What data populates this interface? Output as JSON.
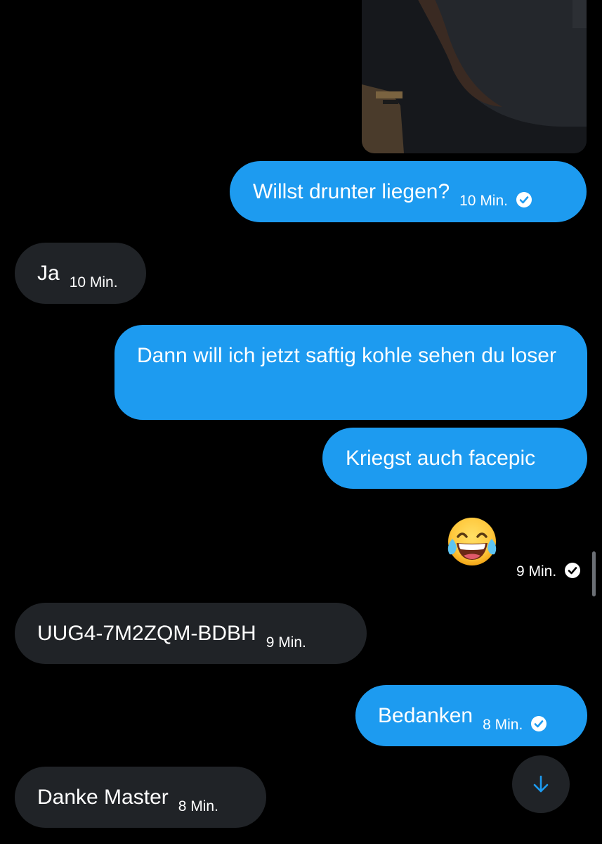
{
  "conversation": {
    "messages": [
      {
        "direction": "outgoing",
        "text": "Willst drunter liegen?",
        "time": "10 Min.",
        "read": true
      },
      {
        "direction": "incoming",
        "text": "Ja",
        "time": "10 Min."
      },
      {
        "direction": "outgoing",
        "text": "Dann will ich jetzt saftig kohle sehen du loser"
      },
      {
        "direction": "outgoing",
        "text": "Kriegst auch facepic"
      },
      {
        "direction": "outgoing",
        "emoji": "face-with-tears-of-joy",
        "time": "9 Min.",
        "read": true
      },
      {
        "direction": "incoming",
        "text": "UUG4-7M2ZQM-BDBH",
        "time": "9 Min."
      },
      {
        "direction": "outgoing",
        "text": "Bedanken",
        "time": "8 Min.",
        "read": true
      },
      {
        "direction": "incoming",
        "text": "Danke Master",
        "time": "8 Min."
      }
    ]
  },
  "icons": {
    "read_receipt": "check-circle-icon",
    "scroll_down": "arrow-down-icon"
  },
  "colors": {
    "background": "#000000",
    "outgoing_bubble": "#1d9bf0",
    "incoming_bubble": "#202327",
    "text": "#ffffff"
  }
}
